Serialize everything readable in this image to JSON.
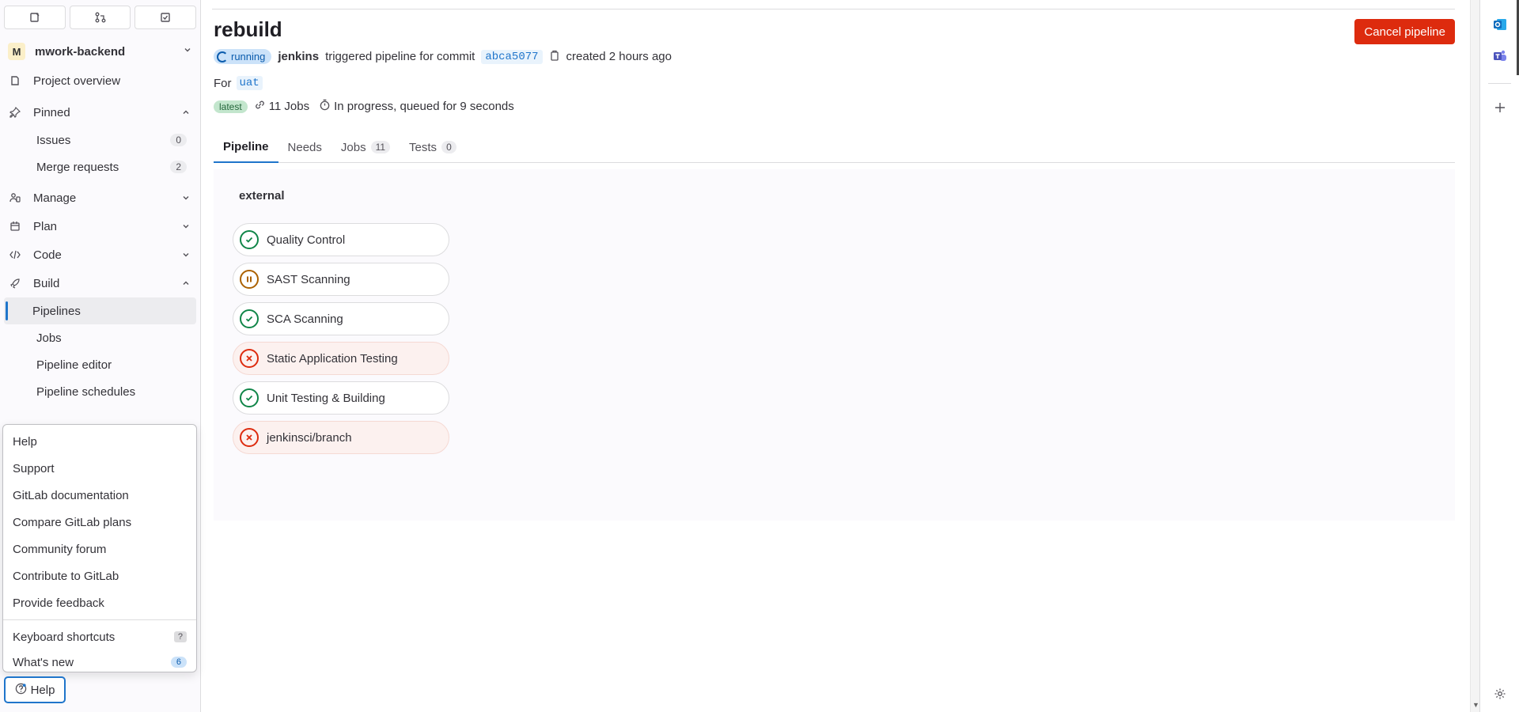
{
  "project": {
    "avatar_letter": "M",
    "name": "mwork-backend"
  },
  "sidebar": {
    "overview": "Project overview",
    "pinned": "Pinned",
    "pinned_items": [
      {
        "label": "Issues",
        "count": "0"
      },
      {
        "label": "Merge requests",
        "count": "2"
      }
    ],
    "sections": {
      "manage": "Manage",
      "plan": "Plan",
      "code": "Code",
      "build": "Build"
    },
    "build_items": [
      "Pipelines",
      "Jobs",
      "Pipeline editor",
      "Pipeline schedules"
    ]
  },
  "help_menu": {
    "items": [
      "Help",
      "Support",
      "GitLab documentation",
      "Compare GitLab plans",
      "Community forum",
      "Contribute to GitLab",
      "Provide feedback"
    ],
    "shortcuts": {
      "label": "Keyboard shortcuts",
      "key": "?"
    },
    "whats_new": {
      "label": "What's new",
      "count": "6"
    },
    "button": "Help"
  },
  "pipeline": {
    "title": "rebuild",
    "cancel_label": "Cancel pipeline",
    "status": "running",
    "user": "jenkins",
    "triggered_text": "triggered pipeline for commit",
    "commit": "abca5077",
    "created": "created 2 hours ago",
    "for_label": "For",
    "ref": "uat",
    "latest": "latest",
    "jobs_count": "11 Jobs",
    "progress": "In progress, queued for 9 seconds"
  },
  "tabs": [
    {
      "label": "Pipeline",
      "count": ""
    },
    {
      "label": "Needs",
      "count": ""
    },
    {
      "label": "Jobs",
      "count": "11"
    },
    {
      "label": "Tests",
      "count": "0"
    }
  ],
  "graph": {
    "stage": "external",
    "jobs": [
      {
        "name": "Quality Control",
        "status": "success"
      },
      {
        "name": "SAST Scanning",
        "status": "manual"
      },
      {
        "name": "SCA Scanning",
        "status": "success"
      },
      {
        "name": "Static Application Testing",
        "status": "failed"
      },
      {
        "name": "Unit Testing & Building",
        "status": "success"
      },
      {
        "name": "jenkinsci/branch",
        "status": "failed"
      }
    ]
  }
}
